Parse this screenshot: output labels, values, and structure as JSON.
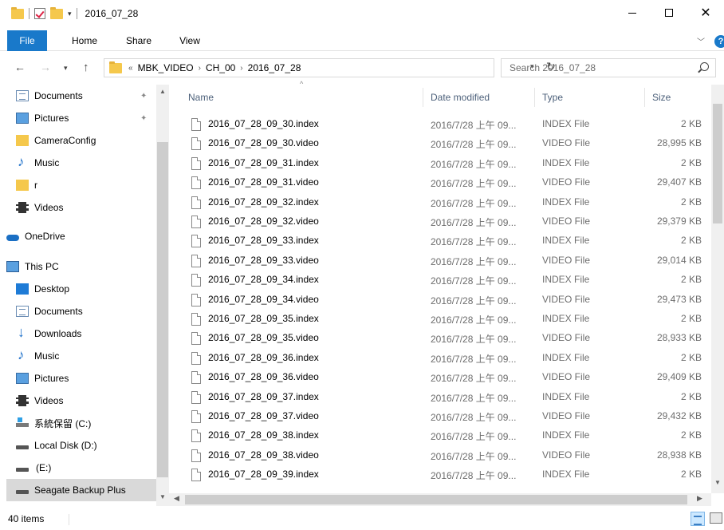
{
  "window": {
    "title": "2016_07_28",
    "quick_access_dropdown": "▾"
  },
  "ribbon": {
    "tabs": [
      "File",
      "Home",
      "Share",
      "View"
    ],
    "help_label": "?"
  },
  "address": {
    "overflow": "«",
    "crumbs": [
      "MBK_VIDEO",
      "CH_00",
      "2016_07_28"
    ],
    "search_placeholder": "Search 2016_07_28"
  },
  "nav_pane": {
    "items": [
      {
        "label": "Documents",
        "icon": "documents-icon",
        "pinned": true
      },
      {
        "label": "Pictures",
        "icon": "pictures-icon",
        "pinned": true
      },
      {
        "label": "CameraConfig",
        "icon": "folder-icon"
      },
      {
        "label": "Music",
        "icon": "music-icon"
      },
      {
        "label": "r",
        "icon": "folder-icon"
      },
      {
        "label": "Videos",
        "icon": "videos-icon"
      },
      {
        "label": "OneDrive",
        "icon": "onedrive-icon"
      },
      {
        "label": "This PC",
        "icon": "pc-icon"
      },
      {
        "label": "Desktop",
        "icon": "desktop-icon"
      },
      {
        "label": "Documents",
        "icon": "documents-icon"
      },
      {
        "label": "Downloads",
        "icon": "downloads-icon"
      },
      {
        "label": "Music",
        "icon": "music-icon"
      },
      {
        "label": "Pictures",
        "icon": "pictures-icon"
      },
      {
        "label": "Videos",
        "icon": "videos-icon"
      },
      {
        "label": "系統保留 (C:)",
        "icon": "system-drive-icon"
      },
      {
        "label": "Local Disk (D:)",
        "icon": "disk-icon"
      },
      {
        "label": "(E:)",
        "icon": "disk-icon"
      },
      {
        "label": "Seagate Backup Plus",
        "icon": "disk-icon",
        "selected": true
      }
    ]
  },
  "columns": {
    "name": "Name",
    "date": "Date modified",
    "type": "Type",
    "size": "Size"
  },
  "files": [
    {
      "name": "2016_07_28_09_30.index",
      "date": "2016/7/28 上午 09...",
      "type": "INDEX File",
      "size": "2 KB"
    },
    {
      "name": "2016_07_28_09_30.video",
      "date": "2016/7/28 上午 09...",
      "type": "VIDEO File",
      "size": "28,995 KB"
    },
    {
      "name": "2016_07_28_09_31.index",
      "date": "2016/7/28 上午 09...",
      "type": "INDEX File",
      "size": "2 KB"
    },
    {
      "name": "2016_07_28_09_31.video",
      "date": "2016/7/28 上午 09...",
      "type": "VIDEO File",
      "size": "29,407 KB"
    },
    {
      "name": "2016_07_28_09_32.index",
      "date": "2016/7/28 上午 09...",
      "type": "INDEX File",
      "size": "2 KB"
    },
    {
      "name": "2016_07_28_09_32.video",
      "date": "2016/7/28 上午 09...",
      "type": "VIDEO File",
      "size": "29,379 KB"
    },
    {
      "name": "2016_07_28_09_33.index",
      "date": "2016/7/28 上午 09...",
      "type": "INDEX File",
      "size": "2 KB"
    },
    {
      "name": "2016_07_28_09_33.video",
      "date": "2016/7/28 上午 09...",
      "type": "VIDEO File",
      "size": "29,014 KB"
    },
    {
      "name": "2016_07_28_09_34.index",
      "date": "2016/7/28 上午 09...",
      "type": "INDEX File",
      "size": "2 KB"
    },
    {
      "name": "2016_07_28_09_34.video",
      "date": "2016/7/28 上午 09...",
      "type": "VIDEO File",
      "size": "29,473 KB"
    },
    {
      "name": "2016_07_28_09_35.index",
      "date": "2016/7/28 上午 09...",
      "type": "INDEX File",
      "size": "2 KB"
    },
    {
      "name": "2016_07_28_09_35.video",
      "date": "2016/7/28 上午 09...",
      "type": "VIDEO File",
      "size": "28,933 KB"
    },
    {
      "name": "2016_07_28_09_36.index",
      "date": "2016/7/28 上午 09...",
      "type": "INDEX File",
      "size": "2 KB"
    },
    {
      "name": "2016_07_28_09_36.video",
      "date": "2016/7/28 上午 09...",
      "type": "VIDEO File",
      "size": "29,409 KB"
    },
    {
      "name": "2016_07_28_09_37.index",
      "date": "2016/7/28 上午 09...",
      "type": "INDEX File",
      "size": "2 KB"
    },
    {
      "name": "2016_07_28_09_37.video",
      "date": "2016/7/28 上午 09...",
      "type": "VIDEO File",
      "size": "29,432 KB"
    },
    {
      "name": "2016_07_28_09_38.index",
      "date": "2016/7/28 上午 09...",
      "type": "INDEX File",
      "size": "2 KB"
    },
    {
      "name": "2016_07_28_09_38.video",
      "date": "2016/7/28 上午 09...",
      "type": "VIDEO File",
      "size": "28,938 KB"
    },
    {
      "name": "2016_07_28_09_39.index",
      "date": "2016/7/28 上午 09...",
      "type": "INDEX File",
      "size": "2 KB"
    }
  ],
  "status": {
    "count": "40 items"
  },
  "colors": {
    "accent": "#1979ca",
    "header_text": "#4c607a",
    "selected_bg": "#d9d9d9"
  }
}
